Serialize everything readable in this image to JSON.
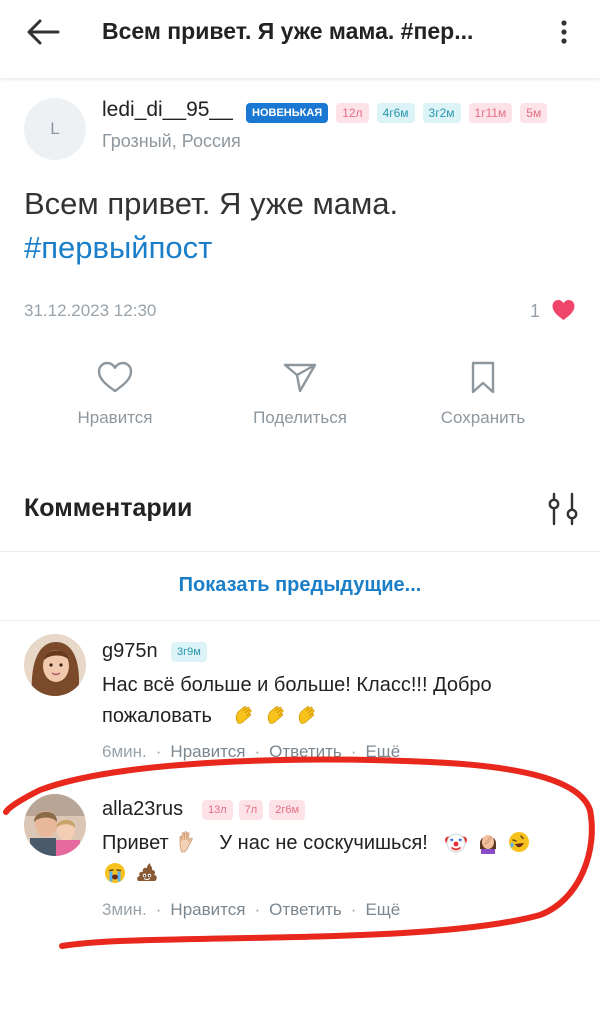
{
  "topbar": {
    "title": "Всем привет. Я уже мама. #пер..."
  },
  "post": {
    "author": {
      "avatar_letter": "L",
      "name": "ledi_di__95__",
      "location": "Грозный, Россия",
      "badges": [
        {
          "text": "НОВЕНЬКАЯ",
          "style": "blue"
        },
        {
          "text": "12л",
          "style": "pink"
        },
        {
          "text": "4г6м",
          "style": "teal"
        },
        {
          "text": "3г2м",
          "style": "teal"
        },
        {
          "text": "1г11м",
          "style": "pink"
        },
        {
          "text": "5м",
          "style": "pink"
        }
      ]
    },
    "text": "Всем привет. Я уже мама.",
    "hashtag": "#первыйпост",
    "date": "31.12.2023 12:30",
    "likes": "1",
    "actions": {
      "like": "Нравится",
      "share": "Поделиться",
      "save": "Сохранить"
    }
  },
  "comments_section": {
    "title": "Комментарии",
    "show_previous": "Показать предыдущие...",
    "comments": [
      {
        "author": "g975n",
        "badges": [
          {
            "text": "3г9м",
            "style": "teal"
          }
        ],
        "text_line1": "Нас всё больше и больше! Класс!!! Добро",
        "text_line2": "пожаловать",
        "emojis": [
          "clapping-hands",
          "clapping-hands",
          "clapping-hands"
        ],
        "time": "6мин.",
        "like": "Нравится",
        "reply": "Ответить",
        "more": "Ещё"
      },
      {
        "author": "alla23rus",
        "badges": [
          {
            "text": "13л",
            "style": "pink"
          },
          {
            "text": "7л",
            "style": "pink"
          },
          {
            "text": "2г6м",
            "style": "pink"
          }
        ],
        "text_part1": "Привет",
        "text_part2": "У нас не соскучишься!",
        "emojis": [
          "raised-hand",
          "clown-face",
          "woman-facepalming",
          "rolling-laughing-face",
          "crying-face",
          "pile-of-poo"
        ],
        "time": "3мин.",
        "like": "Нравится",
        "reply": "Ответить",
        "more": "Ещё"
      }
    ]
  },
  "colors": {
    "accent": "#1a7ec9",
    "badge_blue": "#1a78d2",
    "heart": "#f0456a",
    "annotation_red": "#e8281c"
  }
}
